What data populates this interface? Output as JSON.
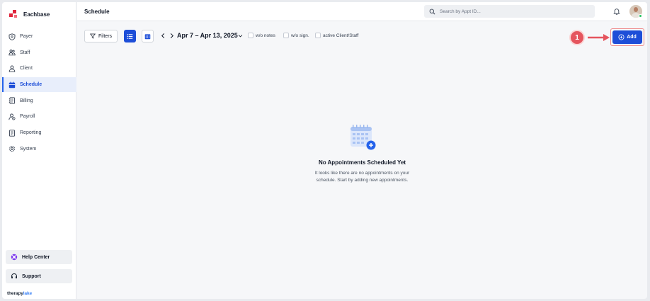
{
  "brand": {
    "name": "Eachbase"
  },
  "sidebar": {
    "items": [
      {
        "label": "Payer",
        "icon": "shield-icon",
        "active": false
      },
      {
        "label": "Staff",
        "icon": "users-icon",
        "active": false
      },
      {
        "label": "Client",
        "icon": "user-icon",
        "active": false
      },
      {
        "label": "Schedule",
        "icon": "calendar-icon",
        "active": true
      },
      {
        "label": "Billing",
        "icon": "invoice-icon",
        "active": false
      },
      {
        "label": "Payroll",
        "icon": "payroll-icon",
        "active": false
      },
      {
        "label": "Reporting",
        "icon": "report-icon",
        "active": false
      },
      {
        "label": "System",
        "icon": "gear-icon",
        "active": false
      }
    ],
    "help_label": "Help Center",
    "support_label": "Support",
    "footer_brand_a": "therapy",
    "footer_brand_b": "lake"
  },
  "header": {
    "title": "Schedule",
    "search_placeholder": "Search by Appt ID..."
  },
  "toolbar": {
    "filters_label": "Filters",
    "date_range": "Apr 7 – Apr 13, 2025",
    "checkbox_no_notes": "w/o notes",
    "checkbox_no_sign": "w/o sign.",
    "checkbox_active": "active Client/Staff",
    "add_label": "Add",
    "step_number": "1"
  },
  "empty_state": {
    "title": "No Appointments Scheduled Yet",
    "description": "It looks like there are no appointments on your schedule. Start by adding new appointments."
  },
  "colors": {
    "primary": "#1d4ed8",
    "brand_red": "#e0243b",
    "highlight": "#e5555e",
    "online": "#22c55e"
  }
}
